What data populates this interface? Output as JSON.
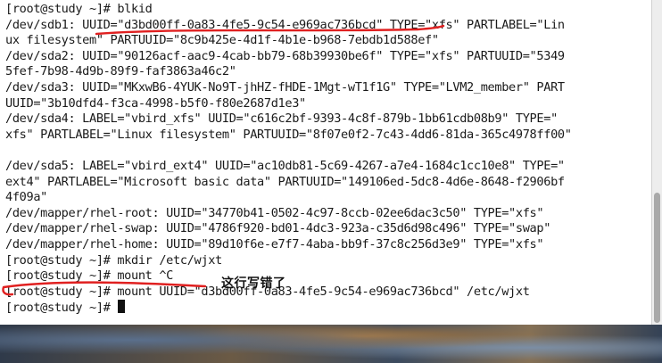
{
  "terminal": {
    "lines": [
      "[root@study ~]# blkid",
      "/dev/sdb1: UUID=\"d3bd00ff-0a83-4fe5-9c54-e969ac736bcd\" TYPE=\"xfs\" PARTLABEL=\"Lin",
      "ux filesystem\" PARTUUID=\"8c9b425e-4d1f-4b1e-b968-7ebdb1d588ef\"",
      "/dev/sda2: UUID=\"90126acf-aac9-4cab-bb79-68b39930be6f\" TYPE=\"xfs\" PARTUUID=\"5349",
      "5fef-7b98-4d9b-89f9-faf3863a46c2\"",
      "/dev/sda3: UUID=\"MKxwB6-4YUK-No9T-jhHZ-fHDE-1Mgt-wT1f1G\" TYPE=\"LVM2_member\" PART",
      "UUID=\"3b10dfd4-f3ca-4998-b5f0-f80e2687d1e3\"",
      "/dev/sda4: LABEL=\"vbird_xfs\" UUID=\"c616c2bf-9393-4c8f-879b-1bb61cdb08b9\" TYPE=\"",
      "xfs\" PARTLABEL=\"Linux filesystem\" PARTUUID=\"8f07e0f2-7c43-4dd6-81da-365c4978ff00\"",
      "",
      "/dev/sda5: LABEL=\"vbird_ext4\" UUID=\"ac10db81-5c69-4267-a7e4-1684c1cc10e8\" TYPE=\"",
      "ext4\" PARTLABEL=\"Microsoft basic data\" PARTUUID=\"149106ed-5dc8-4d6e-8648-f2906bf",
      "4f09a\"",
      "/dev/mapper/rhel-root: UUID=\"34770b41-0502-4c97-8ccb-02ee6dac3c50\" TYPE=\"xfs\"",
      "/dev/mapper/rhel-swap: UUID=\"4786f920-bd01-4dc3-923a-c35d6d98c496\" TYPE=\"swap\"",
      "/dev/mapper/rhel-home: UUID=\"89d10f6e-e7f7-4aba-bb9f-37c8c256d3e9\" TYPE=\"xfs\"",
      "[root@study ~]# mkdir /etc/wjxt",
      "[root@study ~]# mount ^C",
      "[root@study ~]# mount UUID=\"d3bd00ff-0a83-4fe5-9c54-e969ac736bcd\" /etc/wjxt",
      "[root@study ~]# "
    ]
  },
  "annotation": {
    "text": "这行写错了",
    "color": "#e02020"
  }
}
